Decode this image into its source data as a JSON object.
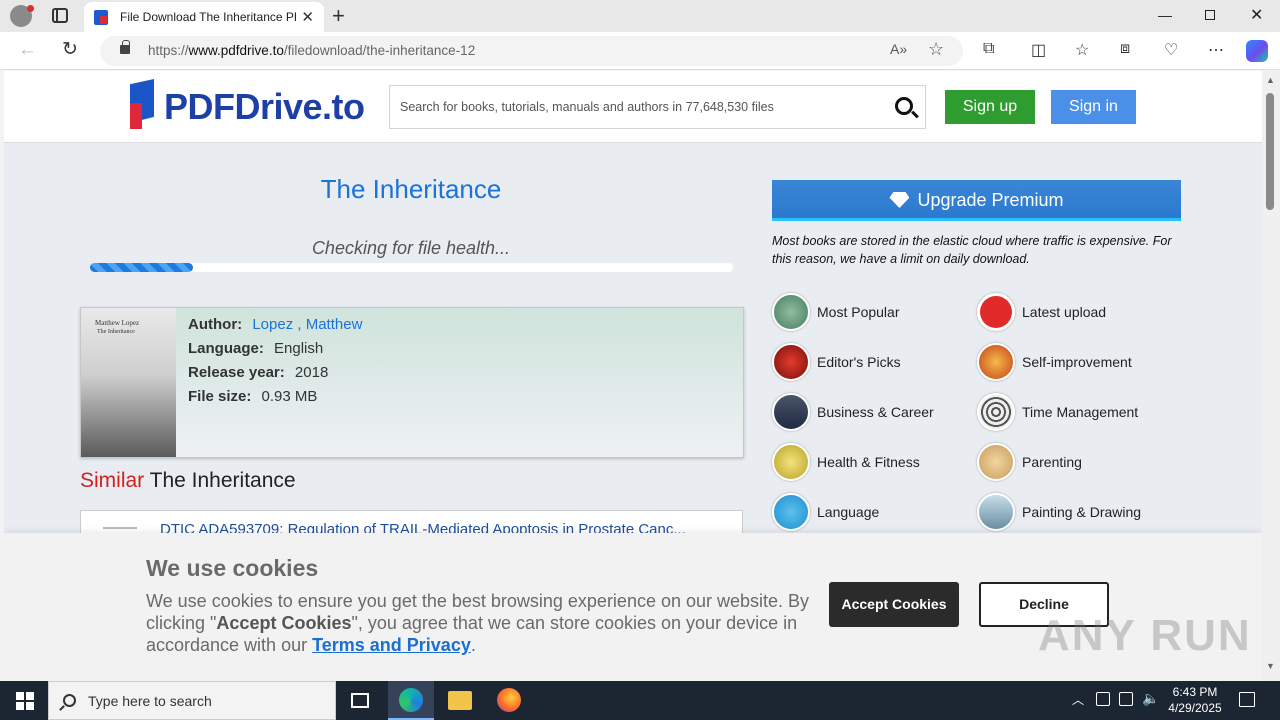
{
  "browser": {
    "tab_title": "File Download The Inheritance PDF",
    "tab_close": "✕",
    "new_tab": "+",
    "url_prefix": "https://",
    "url_domain": "www.pdfdrive.to",
    "url_path": "/filedownload/the-inheritance-12",
    "window_controls": {
      "minimize": "—",
      "close": "✕"
    }
  },
  "site": {
    "logo_text": "PDFDrive.to",
    "search_placeholder": "Search for books, tutorials, manuals and authors in 77,648,530 files",
    "signup_label": "Sign up",
    "signin_label": "Sign in"
  },
  "book": {
    "title": "The Inheritance",
    "health_status": "Checking for file health...",
    "progress_fraction": 0.16,
    "cover_author": "Matthew Lopez",
    "cover_title": "The Inheritance",
    "author_label": "Author:",
    "author_first": "Lopez",
    "author_second": ", Matthew",
    "language_label": "Language:",
    "language": "English",
    "year_label": "Release year:",
    "year": "2018",
    "size_label": "File size:",
    "size": "0.93 MB"
  },
  "similar": {
    "prefix": "Similar",
    "title": "The Inheritance",
    "first_item": "DTIC ADA593709: Regulation of TRAIL-Mediated Apoptosis in Prostate Canc..."
  },
  "sidebar": {
    "premium_label": "Upgrade Premium",
    "premium_note": "Most books are stored in the elastic cloud where traffic is expensive. For this reason, we have a limit on daily download.",
    "categories": [
      {
        "label": "Most Popular",
        "icon": "most-popular-icon"
      },
      {
        "label": "Latest upload",
        "icon": "latest-upload-icon"
      },
      {
        "label": "Editor's Picks",
        "icon": "editors-picks-icon"
      },
      {
        "label": "Self-improvement",
        "icon": "self-improvement-icon"
      },
      {
        "label": "Business & Career",
        "icon": "business-career-icon"
      },
      {
        "label": "Time Management",
        "icon": "time-management-icon"
      },
      {
        "label": "Health & Fitness",
        "icon": "health-fitness-icon"
      },
      {
        "label": "Parenting",
        "icon": "parenting-icon"
      },
      {
        "label": "Language",
        "icon": "language-icon"
      },
      {
        "label": "Painting & Drawing",
        "icon": "painting-drawing-icon"
      }
    ]
  },
  "cookie": {
    "title": "We use cookies",
    "text_1": "We use cookies to ensure you get the best browsing experience on our website. By clicking \"",
    "text_bold": "Accept Cookies",
    "text_2": "\", you agree that we can store cookies on your device in accordance with our ",
    "link": "Terms and Privacy",
    "text_end": ".",
    "accept_label": "Accept Cookies",
    "decline_label": "Decline"
  },
  "watermark": "ANY RUN",
  "taskbar": {
    "search_placeholder": "Type here to search",
    "time": "6:43 PM",
    "date": "4/29/2025"
  },
  "colors": {
    "brand_blue": "#1d3fa8",
    "link_blue": "#1a73d9",
    "signup_green": "#2e9c2f",
    "signin_blue": "#4a90e8",
    "similar_red": "#d0201f"
  }
}
